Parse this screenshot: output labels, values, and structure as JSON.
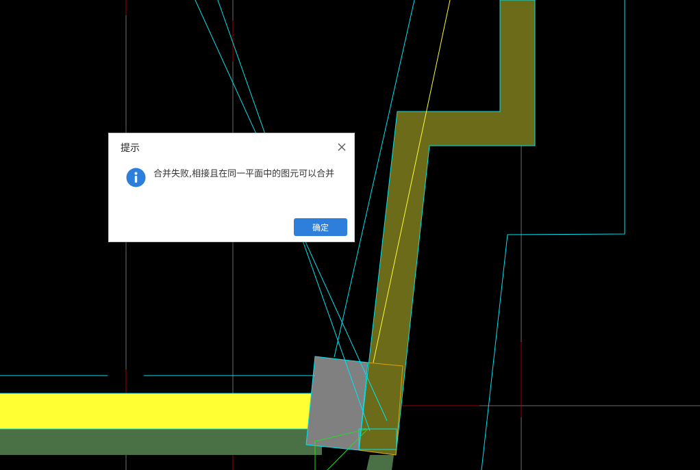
{
  "dialog": {
    "title": "提示",
    "message": "合并失败,相接且在同一平面中的图元可以合并",
    "ok_label": "确定",
    "icon": "info-icon",
    "close_icon": "close-icon"
  },
  "colors": {
    "background": "#000000",
    "grid_line": "#6e6e6e",
    "cyan_edge": "#00e5f0",
    "olive_fill": "#6b6b1a",
    "yellow_fill": "#ffff33",
    "green_fill": "#4a7045",
    "gray_block": "#808080",
    "orange_edge": "#e0a000",
    "red_axis": "#a00000",
    "green_line": "#22dd22",
    "accent_button": "#2e7fdb"
  }
}
